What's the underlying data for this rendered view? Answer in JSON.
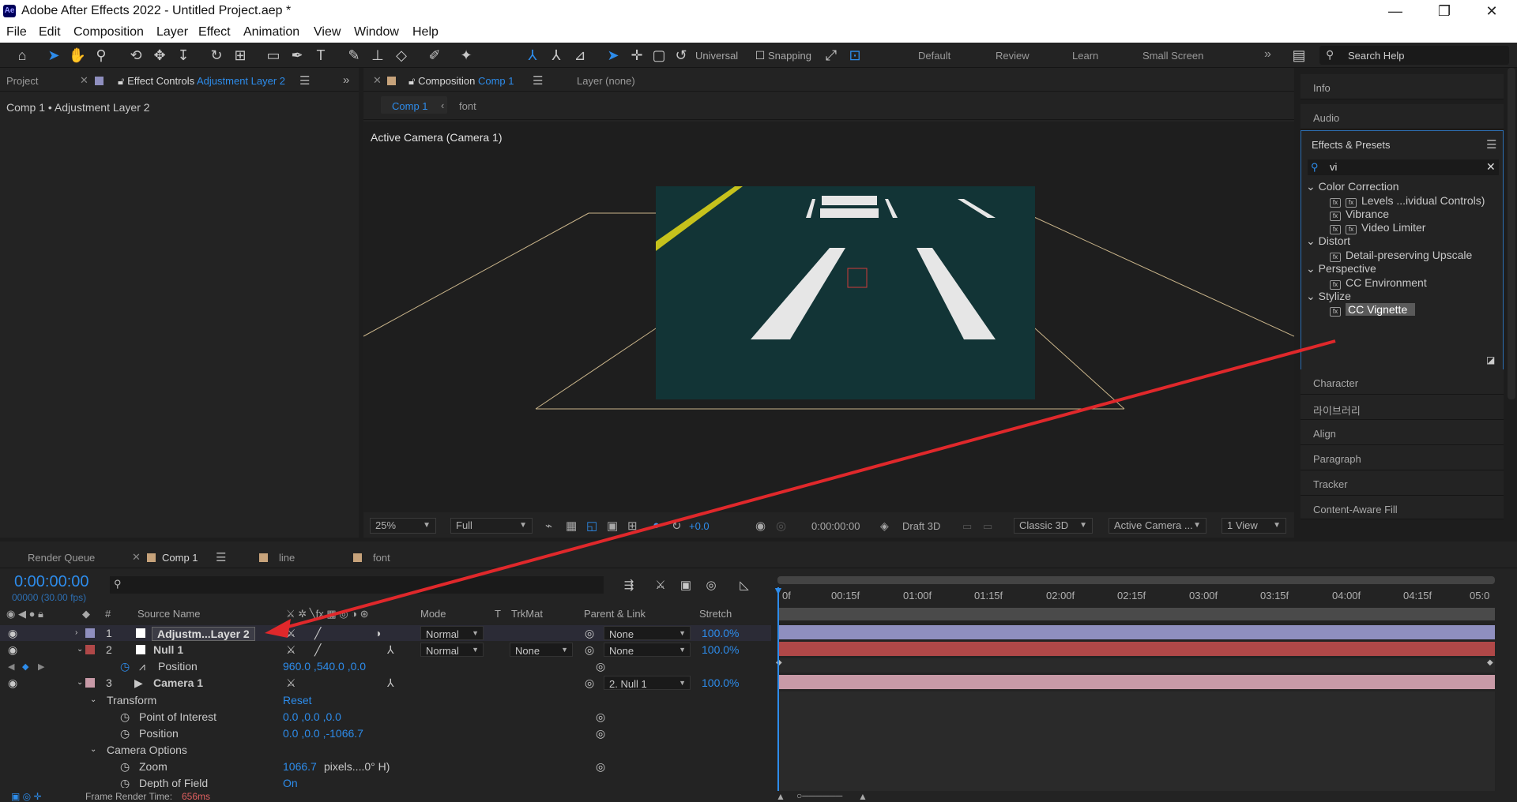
{
  "window": {
    "title": "Adobe After Effects 2022 - Untitled Project.aep *",
    "logo": "Ae",
    "minimize": "—",
    "restore": "❐",
    "close": "✕"
  },
  "menu": [
    "File",
    "Edit",
    "Composition",
    "Layer",
    "Effect",
    "Animation",
    "View",
    "Window",
    "Help"
  ],
  "toolbar": {
    "universal": "Universal",
    "snapping": "Snapping",
    "workspaces": [
      "Default",
      "Review",
      "Learn",
      "Small Screen"
    ],
    "more": "»",
    "search_placeholder": "Search Help"
  },
  "left_panel": {
    "tab_project": "Project",
    "tab_effect_controls": "Effect Controls",
    "effect_controls_layer": "Adjustment Layer 2",
    "breadcrumb": "Comp 1 • Adjustment Layer 2",
    "more": "»"
  },
  "comp_panel": {
    "tab_label": "Composition",
    "tab_comp": "Comp 1",
    "layer_tab": "Layer (none)",
    "subtabs": [
      "Comp 1",
      "font"
    ],
    "camera_label": "Active Camera (Camera 1)"
  },
  "viewer_controls": {
    "zoom": "25%",
    "resolution": "Full",
    "exposure": "+0.0",
    "timecode": "0:00:00:00",
    "draft3d": "Draft 3D",
    "renderer": "Classic 3D",
    "camera": "Active Camera ...",
    "views": "1 View"
  },
  "right_panels": {
    "info": "Info",
    "audio": "Audio",
    "effects_title": "Effects & Presets",
    "search_value": "vi",
    "lower": [
      "Character",
      "라이브러리",
      "Align",
      "Paragraph",
      "Tracker",
      "Content-Aware Fill"
    ]
  },
  "effects_tree": [
    {
      "type": "cat",
      "label": "Color Correction"
    },
    {
      "type": "item",
      "label": "Levels ...ividual Controls)"
    },
    {
      "type": "item",
      "label": "Vibrance"
    },
    {
      "type": "item",
      "label": "Video Limiter"
    },
    {
      "type": "cat",
      "label": "Distort"
    },
    {
      "type": "item",
      "label": "Detail-preserving Upscale"
    },
    {
      "type": "cat",
      "label": "Perspective"
    },
    {
      "type": "item",
      "label": "CC Environment"
    },
    {
      "type": "cat",
      "label": "Stylize"
    },
    {
      "type": "item",
      "label": "CC Vignette",
      "selected": true
    }
  ],
  "timeline": {
    "tabs": [
      "Render Queue",
      "Comp 1",
      "line",
      "font"
    ],
    "timecode": "0:00:00:00",
    "fps": "00000 (30.00 fps)",
    "columns": {
      "num": "#",
      "source": "Source Name",
      "mode": "Mode",
      "t": "T",
      "trkmat": "TrkMat",
      "parent": "Parent & Link",
      "stretch": "Stretch"
    },
    "ruler": [
      "0f",
      "00:15f",
      "01:00f",
      "01:15f",
      "02:00f",
      "02:15f",
      "03:00f",
      "03:15f",
      "04:00f",
      "04:15f",
      "05:0"
    ],
    "rows": [
      {
        "num": "1",
        "name": "Adjustm...Layer 2",
        "mode": "Normal",
        "parent": "None",
        "stretch": "100.0%"
      },
      {
        "num": "2",
        "name": "Null 1",
        "mode": "Normal",
        "trkmat": "None",
        "parent": "None",
        "stretch": "100.0%"
      },
      {
        "prop": "Position",
        "value": "960.0 ,540.0 ,0.0"
      },
      {
        "num": "3",
        "name": "Camera 1",
        "parent": "2. Null 1",
        "stretch": "100.0%"
      },
      {
        "group": "Transform",
        "reset": "Reset"
      },
      {
        "prop": "Point of Interest",
        "value": "0.0 ,0.0 ,0.0"
      },
      {
        "prop": "Position",
        "value": "0.0 ,0.0 ,-1066.7"
      },
      {
        "group": "Camera Options"
      },
      {
        "prop": "Zoom",
        "value": "1066.7",
        "suffix": "pixels....0° H)"
      },
      {
        "prop": "Depth of Field",
        "value": "On"
      }
    ]
  },
  "status": {
    "label": "Frame Render Time:",
    "value": "656ms"
  },
  "colors": {
    "accent": "#2d8ceb",
    "arrow": "#e0282b",
    "layer1": "#8f8fbf",
    "layer2": "#b04848",
    "layer3": "#c89aa7"
  }
}
